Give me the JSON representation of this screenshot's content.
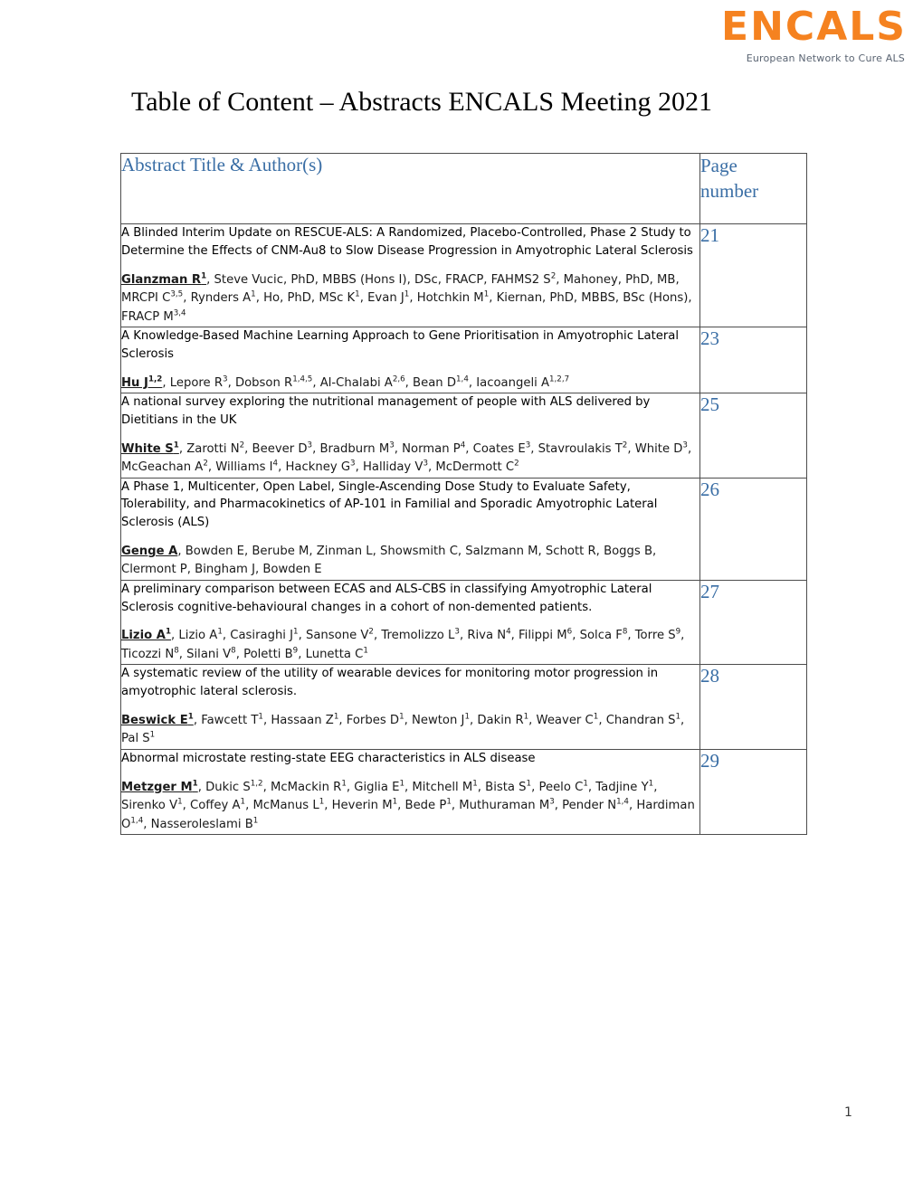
{
  "logo": {
    "wordmark": "ENCALS",
    "tagline": "European Network to Cure ALS",
    "brand_color": "#F58220"
  },
  "document": {
    "title": "Table of Content – Abstracts ENCALS Meeting 2021",
    "footer_page_number": "1",
    "accent_color": "#3a6ea5"
  },
  "table": {
    "headers": {
      "title_column": "Abstract Title & Author(s)",
      "page_column_line1": "Page",
      "page_column_line2": "number"
    },
    "rows": [
      {
        "title": "A Blinded Interim Update on RESCUE-ALS: A Randomized, Placebo-Controlled, Phase 2 Study to Determine the Effects of CNM-Au8 to Slow Disease Progression in Amyotrophic Lateral Sclerosis",
        "lead_author": "Glanzman R",
        "lead_author_sup": "1",
        "authors_rest": ", Steve Vucic, PhD, MBBS (Hons I), DSc, FRACP, FAHMS2 S|2|, Mahoney, PhD, MB, MRCPI C|3,5|, Rynders A|1|, Ho, PhD, MSc K|1|, Evan J|1|, Hotchkin M|1|, Kiernan, PhD, MBBS, BSc (Hons), FRACP M|3,4|",
        "page": "21"
      },
      {
        "title": "A Knowledge-Based Machine Learning Approach to Gene Prioritisation in Amyotrophic Lateral Sclerosis",
        "lead_author": "Hu J",
        "lead_author_sup": "1,2",
        "authors_rest": ", Lepore R|3|, Dobson R|1,4,5|, Al-Chalabi A|2,6|, Bean D|1,4|, Iacoangeli A|1,2,7|",
        "page": "23"
      },
      {
        "title": "A national survey exploring the nutritional management of people with ALS delivered by Dietitians in the UK",
        "lead_author": "White S",
        "lead_author_sup": "1",
        "authors_rest": ", Zarotti N|2|, Beever D|3|, Bradburn M|3|, Norman P|4|, Coates E|3|, Stavroulakis T|2|, White D|3|, McGeachan A|2|, Williams I|4|, Hackney G|3|, Halliday V|3|, McDermott C|2|",
        "page": "25"
      },
      {
        "title": "A Phase 1, Multicenter, Open Label, Single-Ascending Dose Study to Evaluate Safety, Tolerability, and Pharmacokinetics of AP-101 in Familial and Sporadic Amyotrophic Lateral Sclerosis (ALS)",
        "lead_author": "Genge A",
        "lead_author_sup": "",
        "authors_rest": ", Bowden E, Berube M, Zinman L, Showsmith C, Salzmann M, Schott R, Boggs B, Clermont P, Bingham J, Bowden E",
        "page": "26"
      },
      {
        "title": "A preliminary comparison between ECAS and ALS-CBS in classifying Amyotrophic Lateral Sclerosis cognitive-behavioural changes in a cohort of non-demented patients.",
        "lead_author": "Lizio A",
        "lead_author_sup": "1",
        "authors_rest": ", Lizio A|1|, Casiraghi J|1|, Sansone V|2|, Tremolizzo L|3|, Riva N|4|, Filippi M|6|, Solca F|8|, Torre S|9|, Ticozzi N|8|, Silani V|8|, Poletti B|9|, Lunetta C|1|",
        "page": "27"
      },
      {
        "title": "A systematic review of the utility of wearable devices for monitoring motor progression in amyotrophic lateral sclerosis.",
        "lead_author": "Beswick E",
        "lead_author_sup": "1",
        "authors_rest": ", Fawcett T|1|, Hassaan Z|1|, Forbes D|1|, Newton J|1|, Dakin R|1|, Weaver C|1|, Chandran S|1|, Pal S|1|",
        "page": "28"
      },
      {
        "title": "Abnormal microstate resting-state EEG characteristics in ALS disease",
        "lead_author": "Metzger M",
        "lead_author_sup": "1",
        "authors_rest": ", Dukic S|1,2|, McMackin R|1|, Giglia E|1|, Mitchell M|1|, Bista S|1|, Peelo C|1|, Tadjine Y|1|, Sirenko V|1|, Coffey A|1|, McManus L|1|, Heverin M|1|, Bede P|1|, Muthuraman M|3|, Pender N|1,4|, Hardiman O|1,4|, Nasseroleslami B|1|",
        "page": "29"
      }
    ]
  }
}
